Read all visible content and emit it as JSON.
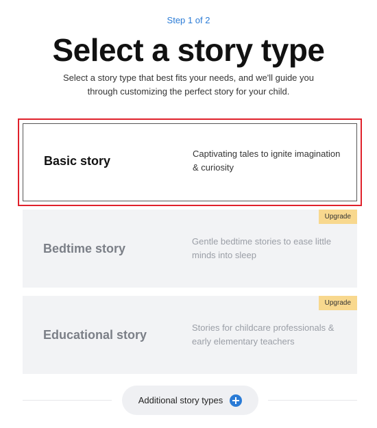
{
  "header": {
    "step": "Step 1 of 2",
    "title": "Select a story type",
    "subtitle": "Select a story type that best fits your needs, and we'll guide you through customizing the perfect story for your child."
  },
  "story_types": [
    {
      "title": "Basic story",
      "description": "Captivating tales to ignite imagination & curiosity",
      "selected": true,
      "badge": ""
    },
    {
      "title": "Bedtime story",
      "description": "Gentle bedtime stories to ease little minds into sleep",
      "selected": false,
      "badge": "Upgrade"
    },
    {
      "title": "Educational story",
      "description": "Stories for childcare professionals & early elementary teachers",
      "selected": false,
      "badge": "Upgrade"
    }
  ],
  "additional": {
    "label": "Additional story types",
    "icon": "plus-circle-icon"
  },
  "colors": {
    "accent": "#2a7bd6",
    "badge": "#f8d88e",
    "highlight": "#e0202a",
    "locked_card": "#f2f3f5"
  }
}
